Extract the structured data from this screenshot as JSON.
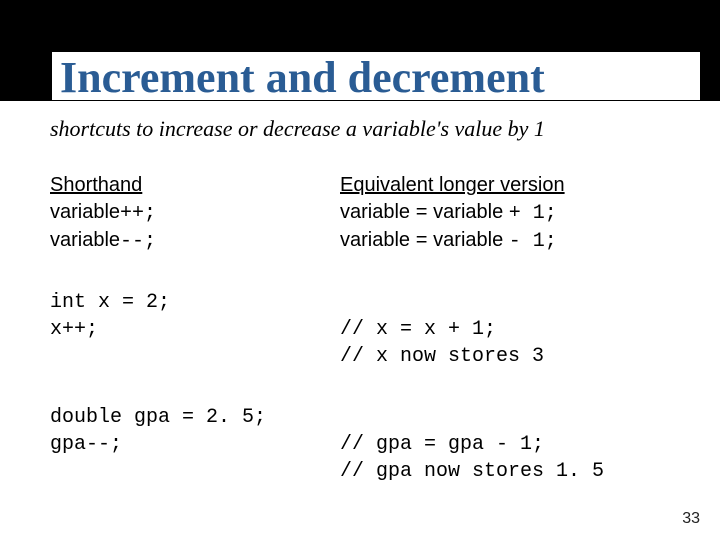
{
  "title": "Increment and decrement",
  "subtitle": "shortcuts to increase or decrease a variable's value by 1",
  "page_number": "33",
  "rows": [
    {
      "left_heading": "Shorthand",
      "left_code_1": "variable++;",
      "left_code_2": "variable--;",
      "right_heading": "Equivalent longer version",
      "right_code_1": "variable = variable + 1;",
      "right_code_2": "variable = variable - 1;"
    },
    {
      "left_code_1": "int x = 2;",
      "left_code_2": "x++;",
      "right_code_1": "// x = x + 1;",
      "right_code_2": "// x now stores 3"
    },
    {
      "left_code_1": "double gpa = 2. 5;",
      "left_code_2": "gpa--;",
      "right_code_1": "// gpa = gpa - 1;",
      "right_code_2": "// gpa now stores 1. 5"
    }
  ]
}
